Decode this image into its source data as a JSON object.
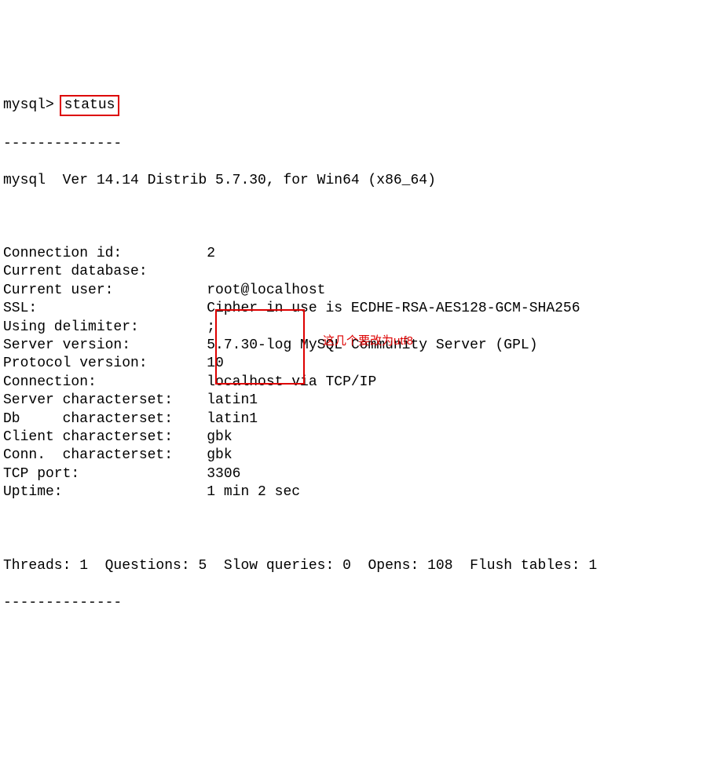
{
  "prompt": "mysql>",
  "command": "status",
  "dashes": "--------------",
  "version_line": "mysql  Ver 14.14 Distrib 5.7.30, for Win64 (x86_64)",
  "rows": [
    {
      "label": "Connection id:",
      "value": "2"
    },
    {
      "label": "Current database:",
      "value": ""
    },
    {
      "label": "Current user:",
      "value": "root@localhost"
    },
    {
      "label": "SSL:",
      "value": "Cipher in use is ECDHE-RSA-AES128-GCM-SHA256"
    },
    {
      "label": "Using delimiter:",
      "value": ";"
    },
    {
      "label": "Server version:",
      "value": "5.7.30-log MySQL Community Server (GPL)"
    },
    {
      "label": "Protocol version:",
      "value": "10"
    },
    {
      "label": "Connection:",
      "value": "localhost via TCP/IP"
    },
    {
      "label": "Server characterset:",
      "value": "latin1"
    },
    {
      "label": "Db     characterset:",
      "value": "latin1"
    },
    {
      "label": "Client characterset:",
      "value": "gbk"
    },
    {
      "label": "Conn.  characterset:",
      "value": "gbk"
    },
    {
      "label": "TCP port:",
      "value": "3306"
    },
    {
      "label": "Uptime:",
      "value": "1 min 2 sec"
    }
  ],
  "stats_line": "Threads: 1  Questions: 5  Slow queries: 0  Opens: 108  Flush tables: 1",
  "annotation": "这几个要改为utf8"
}
